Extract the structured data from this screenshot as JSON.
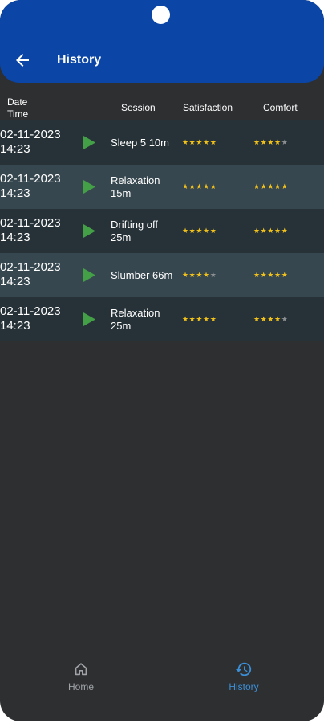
{
  "app_bar": {
    "title": "History"
  },
  "table": {
    "headers": {
      "date_time": "Date\nTime",
      "session": "Session",
      "satisfaction": "Satisfaction",
      "comfort": "Comfort"
    },
    "rows": [
      {
        "date": "02-11-2023",
        "time": "14:23",
        "session": "Sleep 5 10m",
        "satisfaction": 5,
        "comfort": 4
      },
      {
        "date": "02-11-2023",
        "time": "14:23",
        "session": "Relaxation 15m",
        "satisfaction": 5,
        "comfort": 5
      },
      {
        "date": "02-11-2023",
        "time": "14:23",
        "session": "Drifting off 25m",
        "satisfaction": 5,
        "comfort": 5
      },
      {
        "date": "02-11-2023",
        "time": "14:23",
        "session": "Slumber 66m",
        "satisfaction": 4,
        "comfort": 5
      },
      {
        "date": "02-11-2023",
        "time": "14:23",
        "session": "Relaxation 25m",
        "satisfaction": 5,
        "comfort": 4
      }
    ]
  },
  "bottom_nav": {
    "home": {
      "label": "Home",
      "icon": "home-icon"
    },
    "history": {
      "label": "History",
      "icon": "history-icon",
      "active": true
    }
  },
  "colors": {
    "app_bar": "#0b45a6",
    "background": "#2e2f31",
    "row_dark": "#263238",
    "row_light": "#37474f",
    "play": "#43a047",
    "star_on": "#f2c21a",
    "star_off": "#8c8f92",
    "nav_active": "#3b8fd8"
  }
}
